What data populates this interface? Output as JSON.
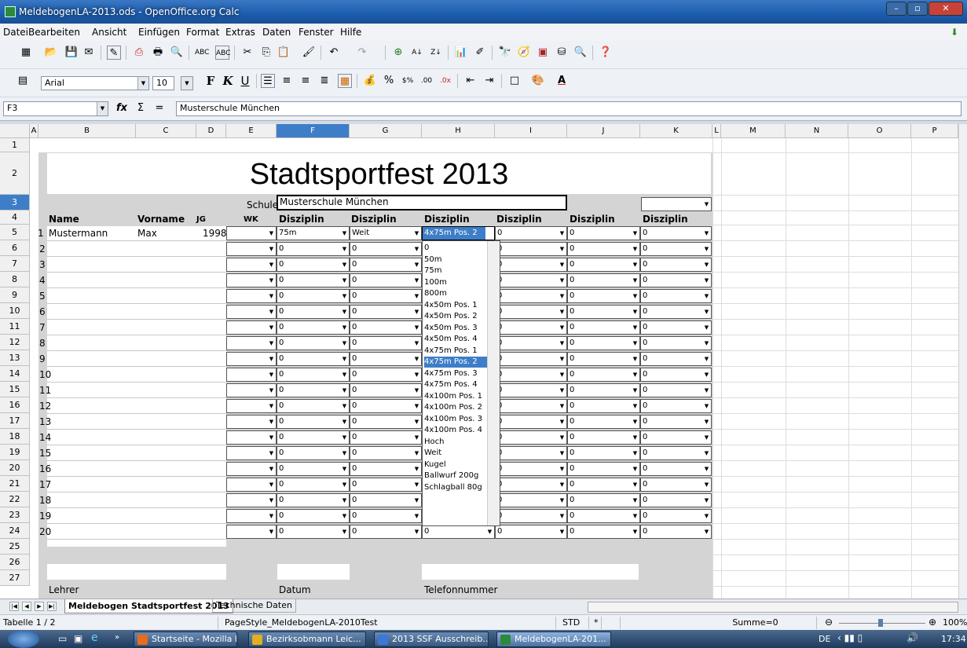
{
  "window": {
    "title": "MeldebogenLA-2013.ods - OpenOffice.org Calc"
  },
  "menu": [
    "Datei",
    "Bearbeiten",
    "Ansicht",
    "Einfügen",
    "Format",
    "Extras",
    "Daten",
    "Fenster",
    "Hilfe"
  ],
  "format_toolbar": {
    "font": "Arial",
    "size": "10",
    "bold": "F",
    "italic": "K",
    "underline": "U"
  },
  "formula_bar": {
    "cell_ref": "F3",
    "content": "Musterschule München"
  },
  "columns": [
    "A",
    "B",
    "C",
    "D",
    "E",
    "F",
    "G",
    "H",
    "I",
    "J",
    "K",
    "L",
    "M",
    "N",
    "O",
    "P"
  ],
  "rows": [
    "1",
    "2",
    "3",
    "4",
    "5",
    "6",
    "7",
    "8",
    "9",
    "10",
    "11",
    "12",
    "13",
    "14",
    "15",
    "16",
    "17",
    "18",
    "19",
    "20",
    "21",
    "22",
    "23",
    "24",
    "25",
    "26",
    "27"
  ],
  "sheet": {
    "title": "Stadtsportfest 2013",
    "school_label": "Schule",
    "school_value": "Musterschule München",
    "headers": {
      "name": "Name",
      "vorname": "Vorname",
      "jg": "JG",
      "wk": "WK",
      "disziplin": "Disziplin"
    },
    "row1": {
      "nr": "1",
      "name": "Mustermann",
      "vorname": "Max",
      "jg": "1998",
      "d1": "75m",
      "d2": "Weit",
      "d3": "4x75m Pos. 2",
      "d4": "0",
      "d5": "0",
      "d6": "0"
    },
    "numbers": [
      "2",
      "3",
      "4",
      "5",
      "6",
      "7",
      "8",
      "9",
      "10",
      "11",
      "12",
      "13",
      "14",
      "15",
      "16",
      "17",
      "18",
      "19",
      "20"
    ],
    "default_value": "0",
    "footer": {
      "lehrer": "Lehrer",
      "datum": "Datum",
      "telefon": "Telefonnummer"
    }
  },
  "dropdown": {
    "options": [
      "0",
      "50m",
      "75m",
      "100m",
      "800m",
      "4x50m Pos. 1",
      "4x50m Pos. 2",
      "4x50m Pos. 3",
      "4x50m Pos. 4",
      "4x75m Pos. 1",
      "4x75m Pos. 2",
      "4x75m Pos. 3",
      "4x75m Pos. 4",
      "4x100m Pos. 1",
      "4x100m Pos. 2",
      "4x100m Pos. 3",
      "4x100m Pos. 4",
      "Hoch",
      "Weit",
      "Kugel",
      "Ballwurf 200g",
      "Schlagball 80g"
    ],
    "selected": "4x75m Pos. 2"
  },
  "sheet_tabs": {
    "active": "Meldebogen Stadtsportfest 2013",
    "other": "Technische Daten"
  },
  "status": {
    "sheet": "Tabelle 1 / 2",
    "pagestyle": "PageStyle_MeldebogenLA-2010Test",
    "mode": "STD",
    "modified": "*",
    "sum": "Summe=0",
    "zoom": "100%"
  },
  "taskbar": {
    "tasks": [
      "Startseite - Mozilla F...",
      "Bezirksobmann Leic...",
      "2013 SSF Ausschreib...",
      "MeldebogenLA-201..."
    ],
    "lang": "DE",
    "time": "17:34"
  }
}
